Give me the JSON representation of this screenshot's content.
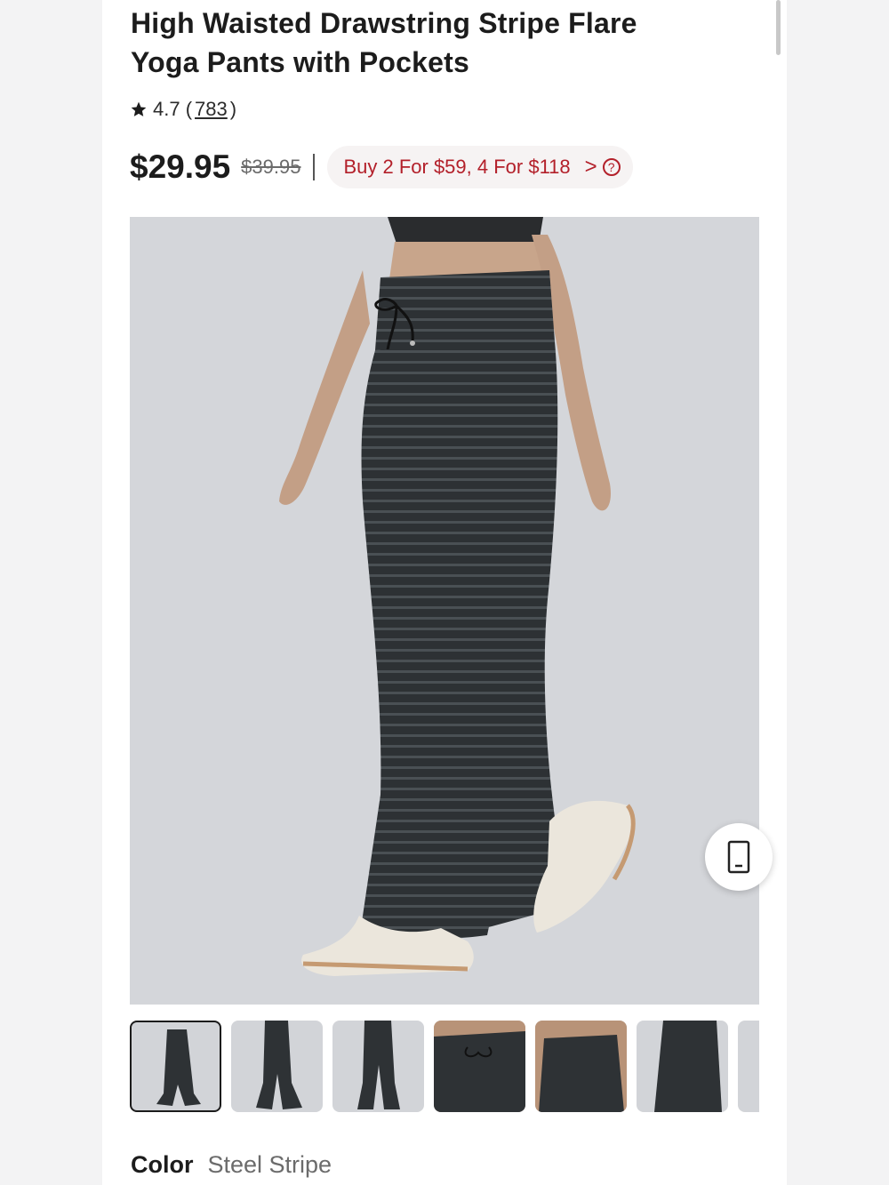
{
  "product": {
    "title_line1": "High Waisted Drawstring Stripe Flare",
    "title_line2": "Yoga Pants with Pockets",
    "rating": "4.7",
    "review_count": "783",
    "price": "$29.95",
    "original_price": "$39.95",
    "promo_text": "Buy 2 For $59, 4 For $118",
    "promo_chevron": ">",
    "promo_help": "?"
  },
  "gallery": {
    "thumbnail_count": 7,
    "selected_index": 0
  },
  "color": {
    "label": "Color",
    "value": "Steel Stripe"
  },
  "colors": {
    "promo_red": "#b3202a",
    "pant_dark": "#2f3336",
    "photo_bg": "#d4d6da"
  }
}
